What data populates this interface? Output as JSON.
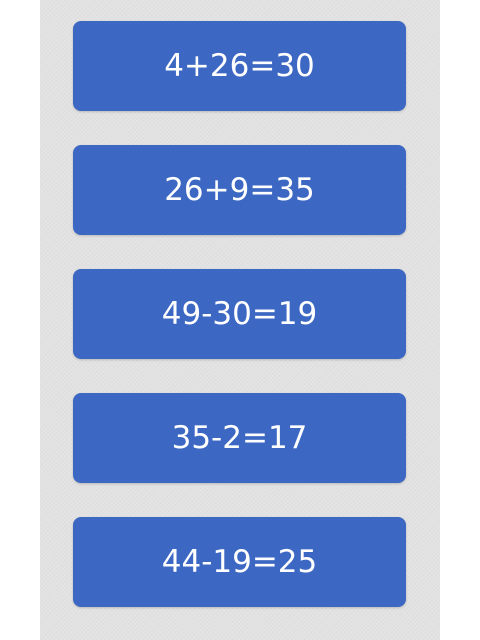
{
  "colors": {
    "button_background": "#3c68c3",
    "button_text": "#ffffff",
    "column_background": "#e2e2e2",
    "page_background": "#ffffff"
  },
  "equations": [
    {
      "label": "4+26=30"
    },
    {
      "label": "26+9=35"
    },
    {
      "label": "49-30=19"
    },
    {
      "label": "35-2=17"
    },
    {
      "label": "44-19=25"
    }
  ]
}
